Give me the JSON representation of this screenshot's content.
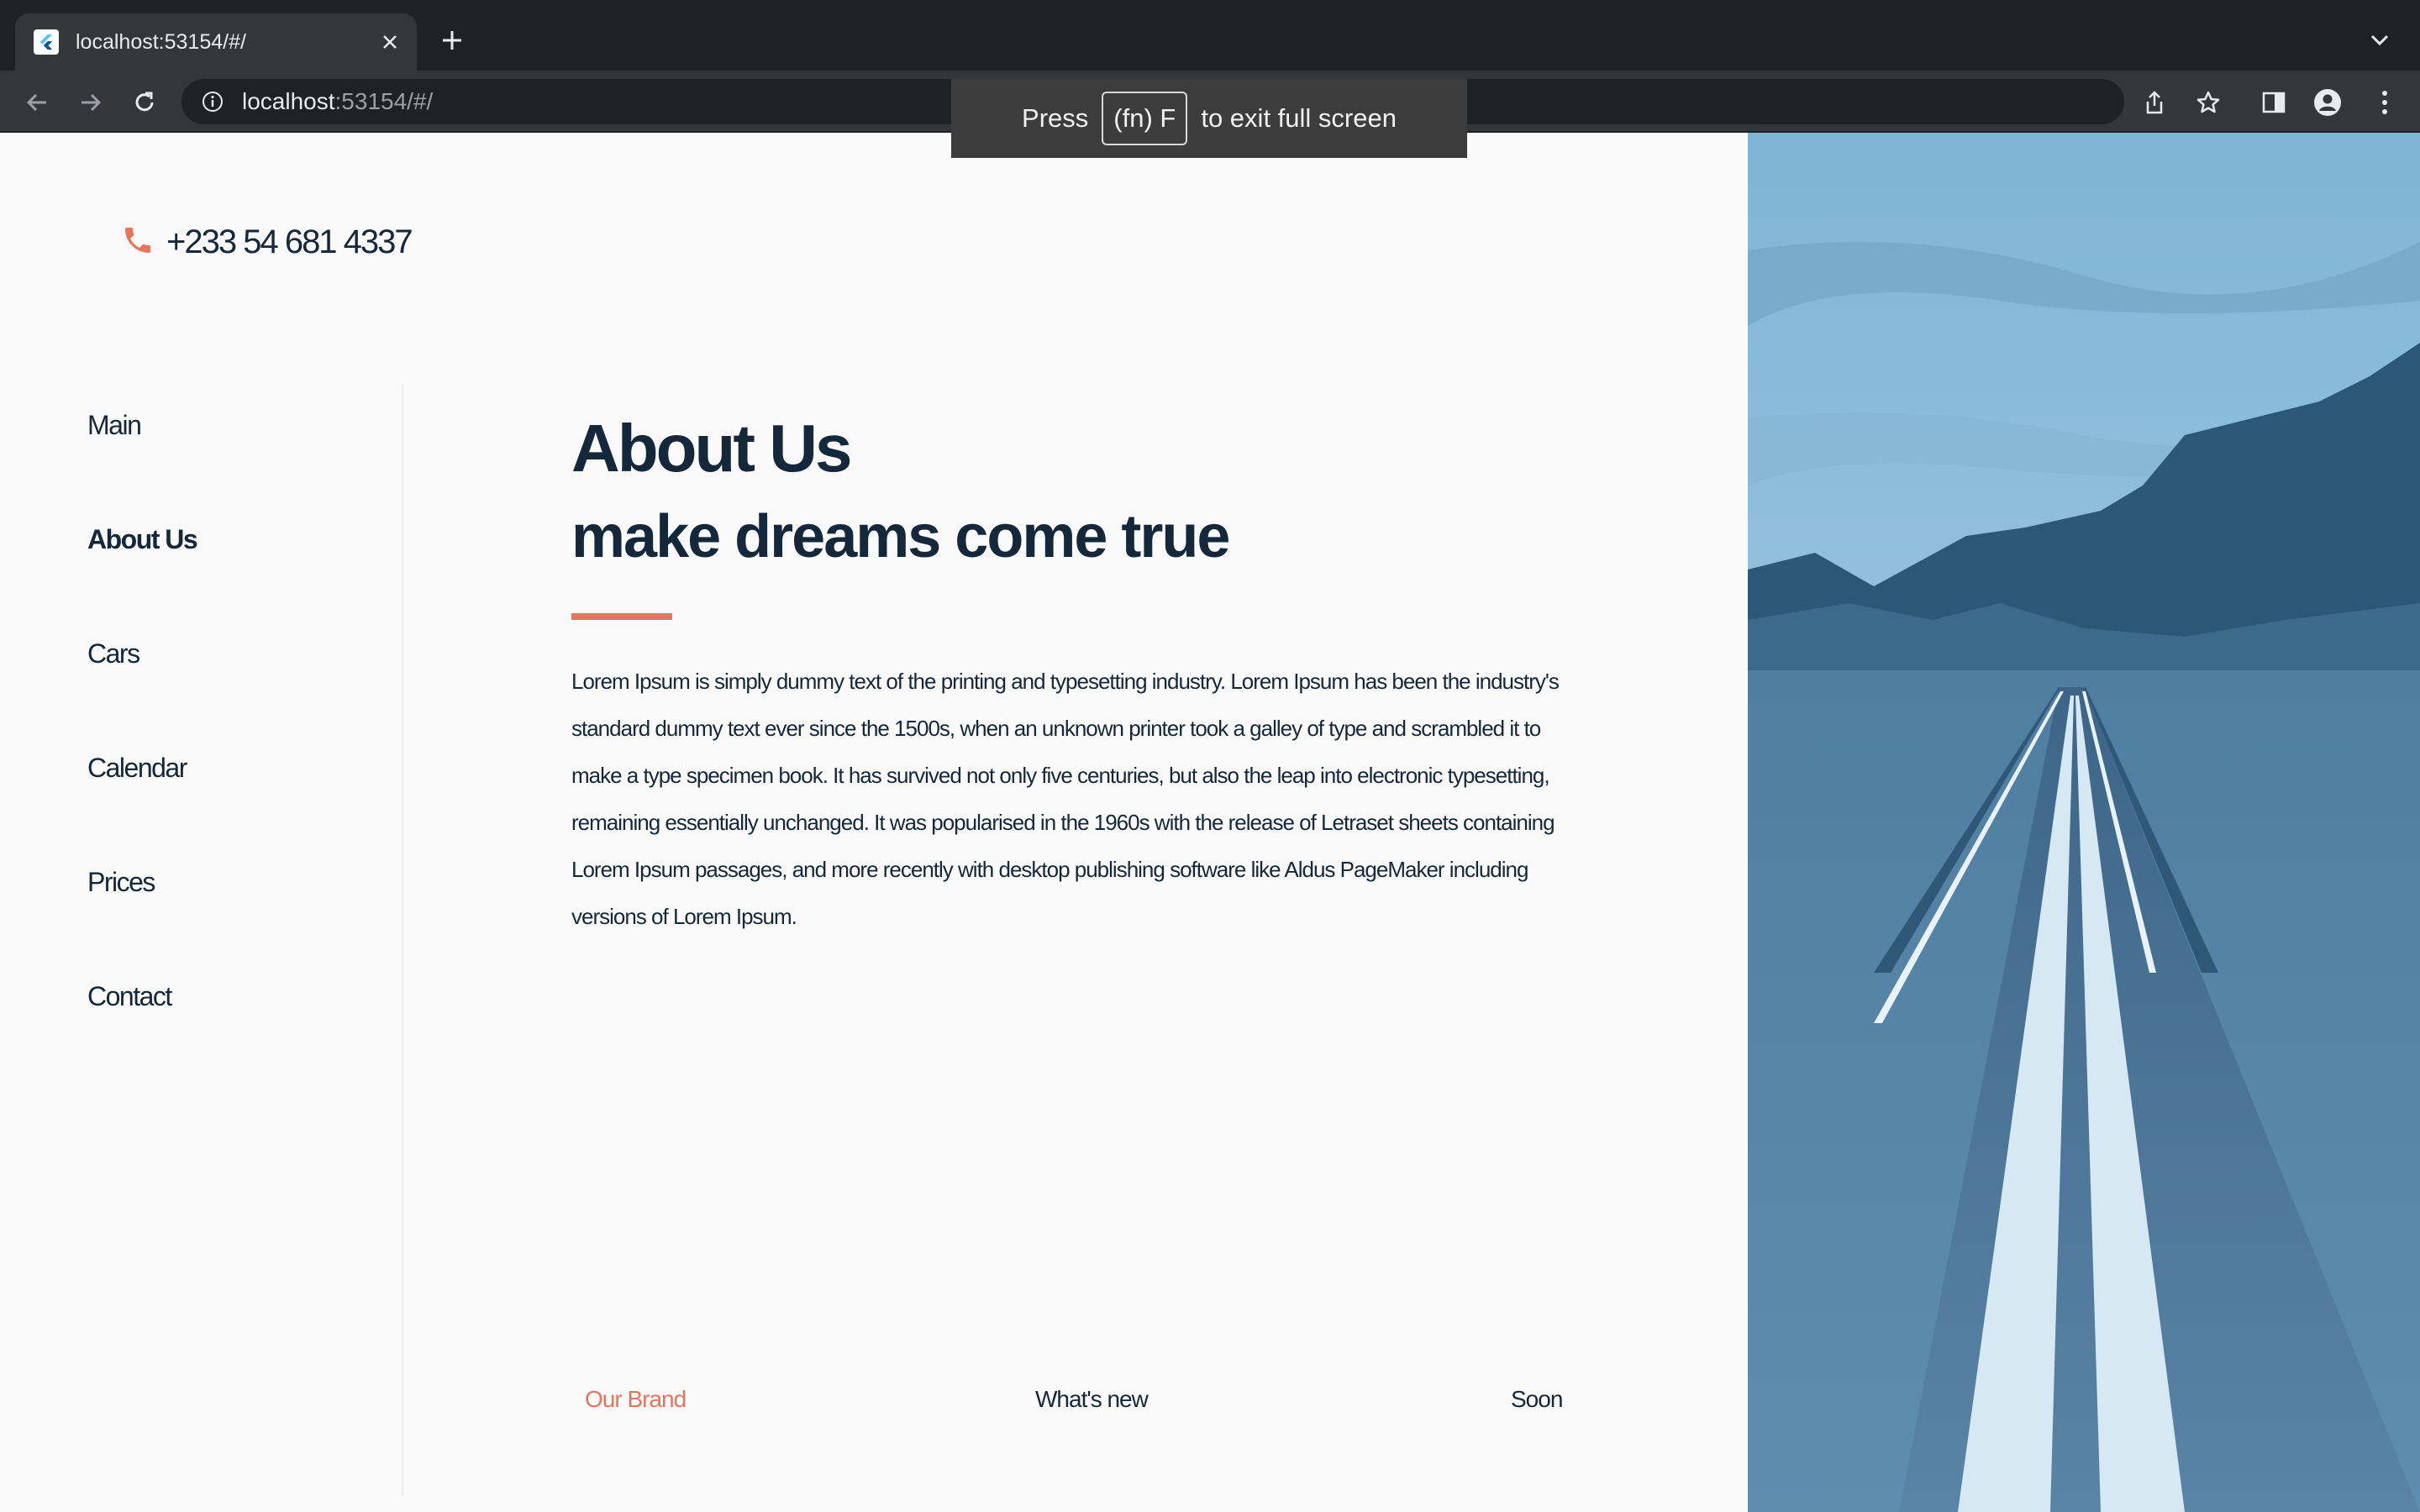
{
  "browser": {
    "tab_title": "localhost:53154/#/",
    "url_host": "localhost",
    "url_rest": ":53154/#/",
    "fullscreen_toast": {
      "press": "Press",
      "key": "(fn) F",
      "rest": "to exit full screen"
    }
  },
  "header": {
    "phone": "+233 54 681 4337"
  },
  "nav": {
    "items": [
      {
        "label": "Main"
      },
      {
        "label": "About Us"
      },
      {
        "label": "Cars"
      },
      {
        "label": "Calendar"
      },
      {
        "label": "Prices"
      },
      {
        "label": "Contact"
      }
    ],
    "active_index": 1
  },
  "content": {
    "title": "About Us",
    "subtitle": "make dreams come true",
    "body": "Lorem Ipsum is simply dummy text of the printing and typesetting industry. Lorem Ipsum has been the industry's standard dummy text ever since the 1500s, when an unknown printer took a galley of type and scrambled it to make a type specimen book. It has survived not only five centuries, but also the leap into electronic typesetting, remaining essentially unchanged. It was popularised in the 1960s with the release of Letraset sheets containing Lorem Ipsum passages, and more recently with desktop publishing software like Aldus PageMaker including versions of Lorem Ipsum."
  },
  "footer": {
    "links": [
      {
        "label": "Our Brand"
      },
      {
        "label": "What's new"
      },
      {
        "label": "Soon"
      }
    ]
  },
  "colors": {
    "accent": "#e5765c",
    "text": "#15283b",
    "background": "#fafafa"
  },
  "icons": [
    "flutter-favicon-icon",
    "close-icon",
    "plus-icon",
    "chevron-down-icon",
    "back-arrow-icon",
    "forward-arrow-icon",
    "reload-icon",
    "info-icon",
    "share-icon",
    "star-icon",
    "side-panel-icon",
    "profile-icon",
    "more-vert-icon",
    "phone-icon"
  ]
}
